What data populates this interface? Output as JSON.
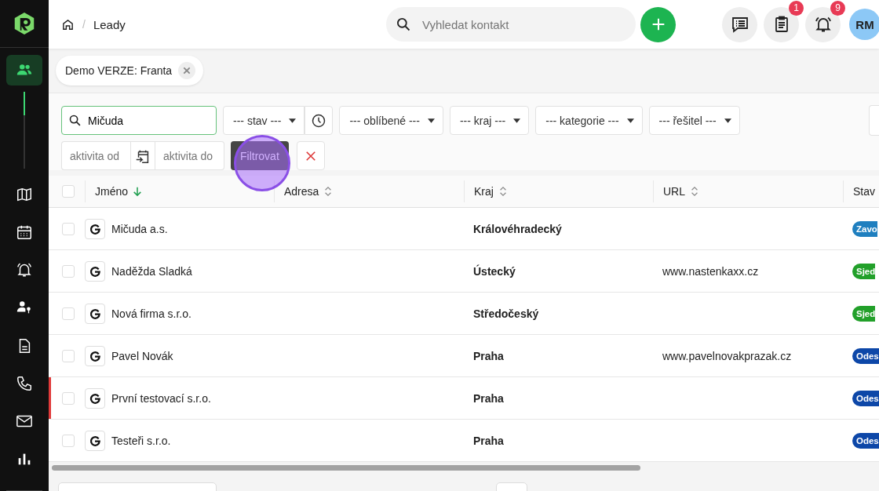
{
  "breadcrumb": {
    "separator": "/",
    "current": "Leady"
  },
  "search": {
    "placeholder": "Vyhledat kontakt"
  },
  "header_badges": [
    {
      "kind": "messages"
    },
    {
      "kind": "tasks",
      "count": "1"
    },
    {
      "kind": "alerts",
      "count": "9"
    }
  ],
  "avatar": {
    "initials": "RM"
  },
  "sidebar": {
    "items": [
      {
        "kind": "users",
        "selected": true
      },
      {
        "kind": "map",
        "selected": false
      },
      {
        "kind": "calendar",
        "selected": false
      },
      {
        "kind": "bell",
        "selected": false
      },
      {
        "kind": "contact",
        "selected": false
      },
      {
        "kind": "document",
        "selected": false
      },
      {
        "kind": "phone",
        "selected": false
      },
      {
        "kind": "mail",
        "selected": false
      },
      {
        "kind": "chart",
        "selected": false
      }
    ]
  },
  "chip": {
    "label": "Demo VERZE: Franta"
  },
  "filters": {
    "search_value": "Mičuda",
    "selects": [
      "--- stav ---",
      "--- oblíbené ---",
      "--- kraj ---",
      "--- kategorie ---",
      "--- řešitel ---"
    ],
    "date_from": {
      "placeholder": "aktivita od"
    },
    "date_to": {
      "placeholder": "aktivita do"
    },
    "filter_button": "Filtrovat"
  },
  "table": {
    "all_checked": false,
    "columns": [
      {
        "label": "Jméno",
        "sorted": true
      },
      {
        "label": "Adresa",
        "sorted": false
      },
      {
        "label": "Kraj",
        "sorted": false
      },
      {
        "label": "URL",
        "sorted": false
      },
      {
        "label": "Stav"
      }
    ],
    "rows": [
      {
        "name": "Mičuda a.s.",
        "kraj": "Královéhradecký",
        "url": "",
        "status": "Zavo",
        "color": "#1f7fbf",
        "flagged": false,
        "checked": false
      },
      {
        "name": "Naděžda Sladká",
        "kraj": "Ústecký",
        "url": "www.nastenkaxx.cz",
        "status": "Sjed",
        "color": "#22a02a",
        "flagged": false,
        "checked": false
      },
      {
        "name": "Nová firma s.r.o.",
        "kraj": "Středočeský",
        "url": "",
        "status": "Sjed",
        "color": "#22a02a",
        "flagged": false,
        "checked": false
      },
      {
        "name": "Pavel Novák",
        "kraj": "Praha",
        "url": "www.pavelnovakprazak.cz",
        "status": "Odes",
        "color": "#0d47a8",
        "flagged": false,
        "checked": false
      },
      {
        "name": "První testovací s.r.o.",
        "kraj": "Praha",
        "url": "",
        "status": "Odes",
        "color": "#0d47a8",
        "flagged": true,
        "checked": false
      },
      {
        "name": "Testeři s.r.o.",
        "kraj": "Praha",
        "url": "",
        "status": "Odes",
        "color": "#0d47a8",
        "flagged": false,
        "checked": false
      }
    ]
  }
}
